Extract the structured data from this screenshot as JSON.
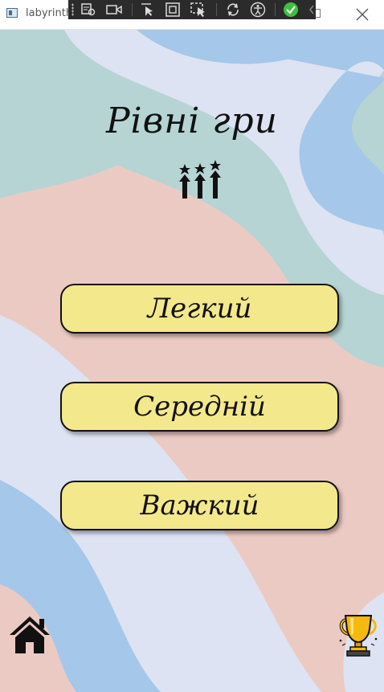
{
  "window": {
    "title": "labyrinth",
    "close_icon": "close-icon",
    "app_icon": "app-window-icon"
  },
  "debug_toolbar": {
    "icons": [
      "select-element-icon",
      "record-video-icon",
      "pointer-icon",
      "layout-adorner-icon",
      "track-focus-icon",
      "hot-reload-icon",
      "accessibility-icon",
      "status-ok-icon",
      "collapse-chevron-icon"
    ],
    "status_color": "#3fbf3f"
  },
  "screen": {
    "title": "Рівні гри",
    "title_icon": "levels-stars-arrows-icon",
    "levels": [
      {
        "label": "Легкий"
      },
      {
        "label": "Середній"
      },
      {
        "label": "Важкий"
      }
    ],
    "home_icon": "home-icon",
    "trophy_icon": "trophy-icon"
  },
  "colors": {
    "button_fill": "#f3e88c",
    "button_border": "#111111",
    "bg_blue": "#a5c7e9",
    "bg_light": "#dde3f2",
    "bg_teal": "#b6d4d4",
    "bg_pink": "#eccac4",
    "trophy_gold": "#f5b90f"
  }
}
